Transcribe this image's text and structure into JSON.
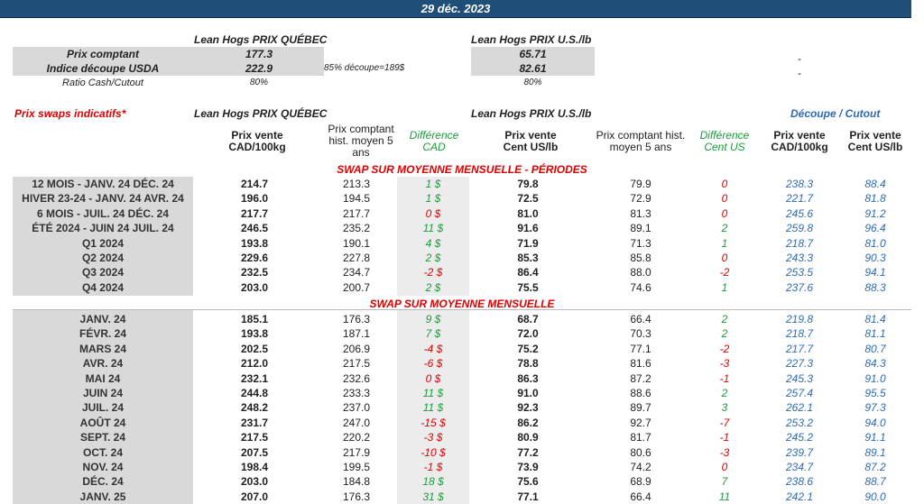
{
  "date": "29 déc. 2023",
  "top": {
    "quebec_title": "Lean Hogs PRIX QUÉBEC",
    "us_title": "Lean Hogs PRIX U.S./lb",
    "rows": [
      {
        "label": "Prix comptant",
        "quebec": "177.3",
        "note": "",
        "us": "65.71",
        "right": "-"
      },
      {
        "label": "Indice découpe USDA",
        "quebec": "222.9",
        "note": "85% découpe=189$",
        "us": "82.61",
        "right": "-"
      },
      {
        "label": "Ratio Cash/Cutout",
        "quebec": "80%",
        "note": "",
        "us": "80%",
        "right": ""
      }
    ]
  },
  "swaps": {
    "title": "Prix swaps indicatifs*",
    "quebec_title": "Lean Hogs PRIX QUÉBEC",
    "us_title": "Lean Hogs PRIX U.S./lb",
    "cutout_title": "Découpe / Cutout",
    "columns": {
      "c1": "Prix vente CAD/100kg",
      "c2": "Prix comptant hist. moyen 5 ans",
      "c3": "Différence CAD",
      "c4": "Prix vente Cent US/lb",
      "c5": "Prix comptant hist. moyen 5 ans",
      "c6": "Différence Cent US",
      "c7": "Prix vente CAD/100kg",
      "c8": "Prix vente Cent US/lb"
    },
    "section1_title": "SWAP SUR MOYENNE MENSUELLE - PÉRIODES",
    "section1_rows": [
      {
        "label": "12 MOIS - JANV. 24 DÉC. 24",
        "c1": "214.7",
        "c2": "213.3",
        "c3": "1 $",
        "c4": "79.8",
        "c5": "79.9",
        "c6": "0",
        "c7": "238.3",
        "c8": "88.4"
      },
      {
        "label": "HIVER 23-24 - JANV. 24 AVR. 24",
        "c1": "196.0",
        "c2": "194.5",
        "c3": "1 $",
        "c4": "72.5",
        "c5": "72.9",
        "c6": "0",
        "c7": "221.7",
        "c8": "81.8"
      },
      {
        "label": "6 MOIS - JUIL. 24 DÉC. 24",
        "c1": "217.7",
        "c2": "217.7",
        "c3": "0 $",
        "c4": "81.0",
        "c5": "81.3",
        "c6": "0",
        "c7": "245.6",
        "c8": "91.2"
      },
      {
        "label": "ÉTÉ 2024 - JUIN 24 JUIL. 24",
        "c1": "246.5",
        "c2": "235.2",
        "c3": "11 $",
        "c4": "91.6",
        "c5": "89.1",
        "c6": "2",
        "c7": "259.8",
        "c8": "96.4"
      },
      {
        "label": "Q1 2024",
        "c1": "193.8",
        "c2": "190.1",
        "c3": "4 $",
        "c4": "71.9",
        "c5": "71.3",
        "c6": "1",
        "c7": "218.7",
        "c8": "81.0"
      },
      {
        "label": "Q2 2024",
        "c1": "229.6",
        "c2": "227.8",
        "c3": "2 $",
        "c4": "85.3",
        "c5": "85.8",
        "c6": "0",
        "c7": "243.3",
        "c8": "90.3"
      },
      {
        "label": "Q3 2024",
        "c1": "232.5",
        "c2": "234.7",
        "c3": "-2 $",
        "c4": "86.4",
        "c5": "88.0",
        "c6": "-2",
        "c7": "253.5",
        "c8": "94.1"
      },
      {
        "label": "Q4 2024",
        "c1": "203.0",
        "c2": "200.7",
        "c3": "2 $",
        "c4": "75.5",
        "c5": "74.6",
        "c6": "1",
        "c7": "237.6",
        "c8": "88.3"
      }
    ],
    "section2_title": "SWAP SUR MOYENNE MENSUELLE",
    "section2_rows": [
      {
        "label": "JANV. 24",
        "c1": "185.1",
        "c2": "176.3",
        "c3": "9 $",
        "c4": "68.7",
        "c5": "66.4",
        "c6": "2",
        "c7": "219.8",
        "c8": "81.4"
      },
      {
        "label": "FÉVR. 24",
        "c1": "193.8",
        "c2": "187.1",
        "c3": "7 $",
        "c4": "72.0",
        "c5": "70.3",
        "c6": "2",
        "c7": "218.7",
        "c8": "81.1"
      },
      {
        "label": "MARS 24",
        "c1": "202.5",
        "c2": "206.9",
        "c3": "-4 $",
        "c4": "75.2",
        "c5": "77.1",
        "c6": "-2",
        "c7": "217.7",
        "c8": "80.7"
      },
      {
        "label": "AVR. 24",
        "c1": "212.0",
        "c2": "217.5",
        "c3": "-6 $",
        "c4": "78.8",
        "c5": "81.6",
        "c6": "-3",
        "c7": "227.3",
        "c8": "84.3"
      },
      {
        "label": "MAI 24",
        "c1": "232.1",
        "c2": "232.6",
        "c3": "0 $",
        "c4": "86.3",
        "c5": "87.2",
        "c6": "-1",
        "c7": "245.3",
        "c8": "91.0"
      },
      {
        "label": "JUIN 24",
        "c1": "244.8",
        "c2": "233.3",
        "c3": "11 $",
        "c4": "91.0",
        "c5": "88.6",
        "c6": "2",
        "c7": "257.4",
        "c8": "95.5"
      },
      {
        "label": "JUIL. 24",
        "c1": "248.2",
        "c2": "237.0",
        "c3": "11 $",
        "c4": "92.3",
        "c5": "89.7",
        "c6": "3",
        "c7": "262.1",
        "c8": "97.3"
      },
      {
        "label": "AOÛT 24",
        "c1": "231.7",
        "c2": "247.0",
        "c3": "-15 $",
        "c4": "86.2",
        "c5": "92.7",
        "c6": "-7",
        "c7": "253.2",
        "c8": "94.0"
      },
      {
        "label": "SEPT. 24",
        "c1": "217.5",
        "c2": "220.2",
        "c3": "-3 $",
        "c4": "80.9",
        "c5": "81.7",
        "c6": "-1",
        "c7": "245.2",
        "c8": "91.1"
      },
      {
        "label": "OCT. 24",
        "c1": "207.5",
        "c2": "217.9",
        "c3": "-10 $",
        "c4": "77.2",
        "c5": "80.6",
        "c6": "-3",
        "c7": "239.7",
        "c8": "89.1"
      },
      {
        "label": "NOV. 24",
        "c1": "198.4",
        "c2": "199.5",
        "c3": "-1 $",
        "c4": "73.9",
        "c5": "74.2",
        "c6": "0",
        "c7": "234.7",
        "c8": "87.2"
      },
      {
        "label": "DÉC. 24",
        "c1": "203.0",
        "c2": "184.8",
        "c3": "18 $",
        "c4": "75.6",
        "c5": "68.9",
        "c6": "7",
        "c7": "238.6",
        "c8": "88.7"
      },
      {
        "label": "JANV. 25",
        "c1": "207.0",
        "c2": "176.3",
        "c3": "31 $",
        "c4": "77.1",
        "c5": "66.4",
        "c6": "11",
        "c7": "242.1",
        "c8": "90.0"
      }
    ]
  }
}
